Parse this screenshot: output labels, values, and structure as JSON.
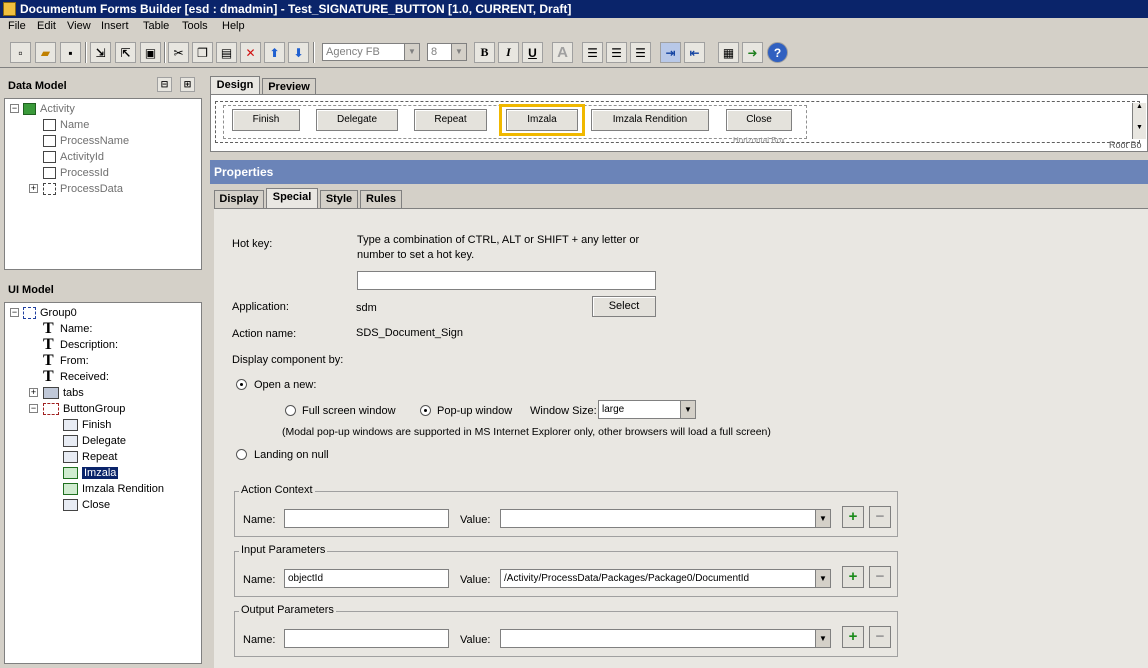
{
  "window": {
    "title": "Documentum Forms Builder [esd : dmadmin] - Test_SIGNATURE_BUTTON [1.0, CURRENT, Draft]"
  },
  "menu": [
    "File",
    "Edit",
    "View",
    "Insert",
    "Table",
    "Tools",
    "Help"
  ],
  "toolbar": {
    "font_name": "Agency FB",
    "font_size": "8",
    "bold": "B",
    "italic": "I",
    "underline": "U",
    "color": "A"
  },
  "data_model": {
    "title": "Data Model",
    "root": "Activity",
    "items": [
      "Name",
      "ProcessName",
      "ActivityId",
      "ProcessId",
      "ProcessData"
    ]
  },
  "ui_model": {
    "title": "UI Model",
    "root": "Group0",
    "text_items": [
      "Name:",
      "Description:",
      "From:",
      "Received:"
    ],
    "tabs": "tabs",
    "button_group": "ButtonGroup",
    "buttons": [
      "Finish",
      "Delegate",
      "Repeat",
      "Imzala",
      "Imzala Rendition",
      "Close"
    ],
    "selected": "Imzala"
  },
  "design_tabs": [
    "Design",
    "Preview"
  ],
  "canvas": {
    "buttons": [
      "Finish",
      "Delegate",
      "Repeat",
      "Imzala",
      "Imzala Rendition",
      "Close"
    ],
    "hbox_label": "Horizontal Box",
    "root_label": "Root Bo"
  },
  "properties": {
    "title": "Properties",
    "tabs": [
      "Display",
      "Special",
      "Style",
      "Rules"
    ],
    "active_tab": "Special",
    "hotkey_label": "Hot key:",
    "hotkey_help": "Type a combination of CTRL, ALT or SHIFT + any letter or",
    "hotkey_help2": "number to set a hot key.",
    "hotkey_value": "",
    "application_label": "Application:",
    "application_value": "sdm",
    "select_button": "Select",
    "action_name_label": "Action name:",
    "action_name_value": "SDS_Document_Sign",
    "display_by_label": "Display component by:",
    "open_new": "Open a new:",
    "full_screen": "Full screen window",
    "popup": "Pop-up window",
    "window_size_label": "Window Size:",
    "window_size_value": "large",
    "modal_note": "(Modal pop-up windows are supported in MS Internet Explorer only, other browsers will load a full screen)",
    "landing_on_null": "Landing on null",
    "groups": [
      {
        "title": "Action Context",
        "name_label": "Name:",
        "name_value": "",
        "value_label": "Value:",
        "value": ""
      },
      {
        "title": "Input Parameters",
        "name_label": "Name:",
        "name_value": "objectId",
        "value_label": "Value:",
        "value": "/Activity/ProcessData/Packages/Package0/DocumentId"
      },
      {
        "title": "Output Parameters",
        "name_label": "Name:",
        "name_value": "",
        "value_label": "Value:",
        "value": ""
      }
    ],
    "plus": "+",
    "minus": "−"
  },
  "colors": {
    "titlebar": "#0a246a",
    "properties_header": "#6b84b8",
    "selection": "#0a246a",
    "highlight_border": "#f0b800"
  }
}
